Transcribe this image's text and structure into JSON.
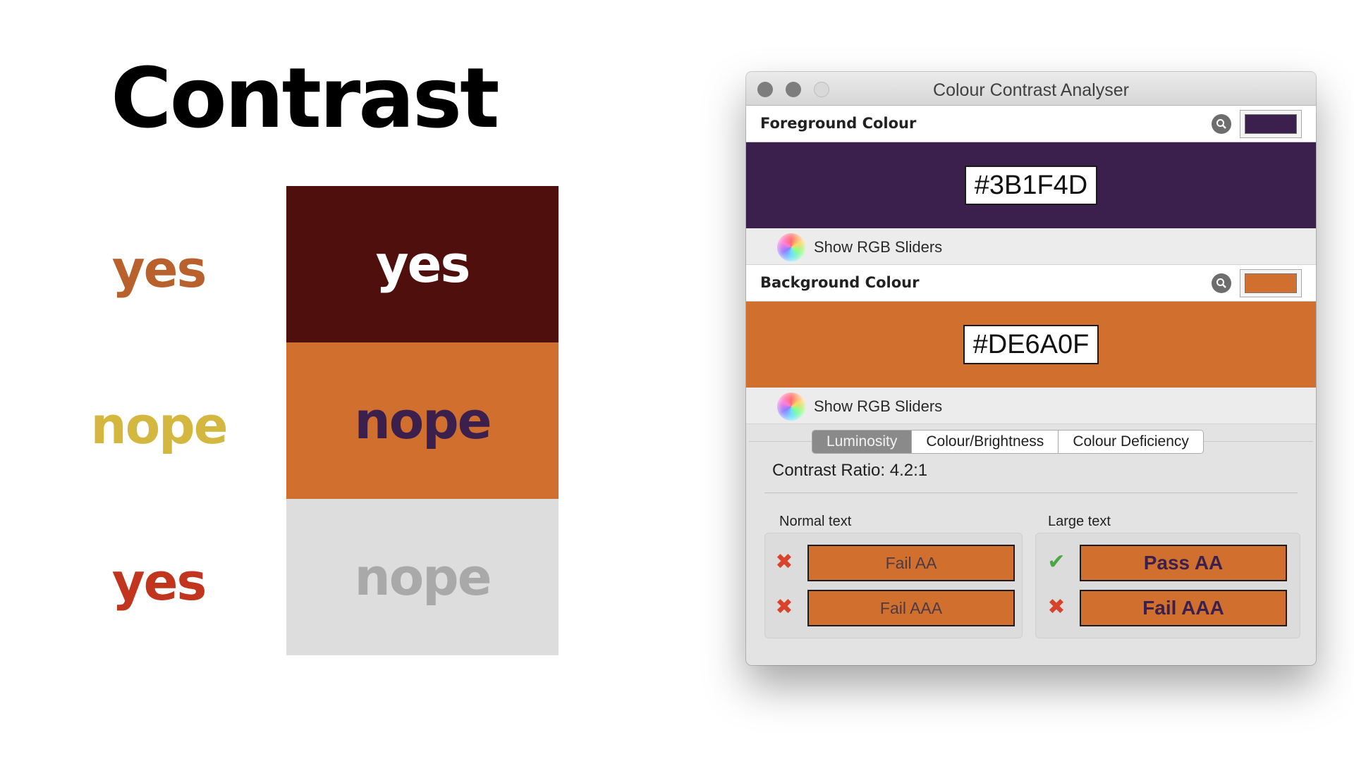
{
  "slide": {
    "title": "Contrast",
    "rows": [
      {
        "left_text": "yes",
        "left_color": "#b8612c",
        "swatch_text": "yes",
        "swatch_text_color": "#ffffff",
        "swatch_bg": "#4f0f0d"
      },
      {
        "left_text": "nope",
        "left_color": "#d3b73e",
        "swatch_text": "nope",
        "swatch_text_color": "#3b1f4d",
        "swatch_bg": "#d06f2e"
      },
      {
        "left_text": "yes",
        "left_color": "#c1341d",
        "swatch_text": "nope",
        "swatch_text_color": "#a9a9a9",
        "swatch_bg": "#dddddd"
      }
    ]
  },
  "window": {
    "title": "Colour Contrast Analyser",
    "foreground": {
      "label": "Foreground Colour",
      "hex": "#3B1F4D",
      "color": "#3b1f4d",
      "rgb_sliders_label": "Show RGB Sliders",
      "picker_icon": "magnifier-icon"
    },
    "background": {
      "label": "Background Colour",
      "hex": "#DE6A0F",
      "color": "#d06f2e",
      "rgb_sliders_label": "Show RGB Sliders",
      "picker_icon": "magnifier-icon"
    },
    "tabs": [
      {
        "label": "Luminosity",
        "active": true
      },
      {
        "label": "Colour/Brightness",
        "active": false
      },
      {
        "label": "Colour Deficiency",
        "active": false
      }
    ],
    "contrast_ratio": "Contrast Ratio: 4.2:1",
    "normal_text": {
      "label": "Normal text",
      "results": [
        {
          "status": "fail",
          "icon": "cross-icon",
          "label": "Fail AA"
        },
        {
          "status": "fail",
          "icon": "cross-icon",
          "label": "Fail AAA"
        }
      ]
    },
    "large_text": {
      "label": "Large text",
      "results": [
        {
          "status": "pass",
          "icon": "check-icon",
          "label": "Pass AA"
        },
        {
          "status": "fail",
          "icon": "cross-icon",
          "label": "Fail AAA"
        }
      ]
    }
  }
}
